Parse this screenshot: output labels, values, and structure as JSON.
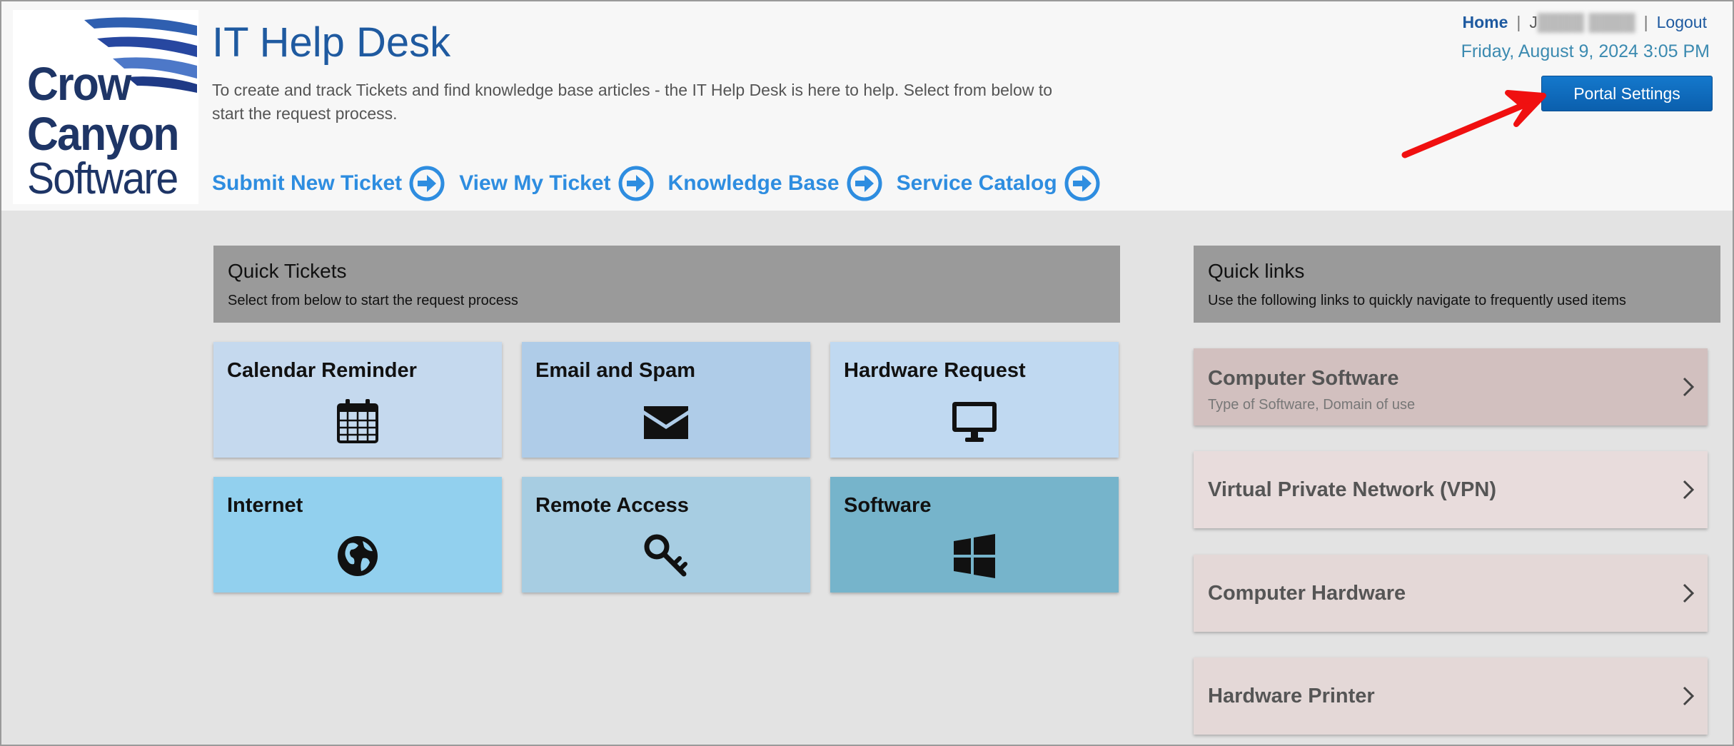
{
  "brand": {
    "logo_line1": "Crow",
    "logo_line2": "Canyon",
    "logo_line3": "Software",
    "color_dark": "#1e3566"
  },
  "header": {
    "title": "IT Help Desk",
    "description": "To create and track Tickets and find knowledge base articles - the IT Help Desk is here to help. Select from below to start the request process.",
    "home_label": "Home",
    "sep1": "|",
    "user_label": "J",
    "user_redacted": "████ ████",
    "sep2": "|",
    "logout_label": "Logout",
    "datetime": "Friday, August 9, 2024 3:05 PM",
    "portal_settings_label": "Portal Settings"
  },
  "nav": [
    {
      "label": "Submit New Ticket",
      "icon": "arrow-circle-right-icon"
    },
    {
      "label": "View My Ticket",
      "icon": "arrow-circle-right-icon"
    },
    {
      "label": "Knowledge Base",
      "icon": "arrow-circle-right-icon"
    },
    {
      "label": "Service Catalog",
      "icon": "arrow-circle-right-icon"
    }
  ],
  "quick_tickets": {
    "title": "Quick Tickets",
    "subtitle": "Select from below to start the request process",
    "tiles": [
      {
        "label": "Calendar Reminder",
        "icon": "calendar-icon",
        "color": "#c5d9ee"
      },
      {
        "label": "Email and Spam",
        "icon": "envelope-icon",
        "color": "#afcce8"
      },
      {
        "label": "Hardware Request",
        "icon": "monitor-icon",
        "color": "#c0d9f1"
      },
      {
        "label": "Internet",
        "icon": "globe-icon",
        "color": "#92d0ee"
      },
      {
        "label": "Remote Access",
        "icon": "key-icon",
        "color": "#a7cde2"
      },
      {
        "label": "Software",
        "icon": "windows-icon",
        "color": "#76b4cb"
      }
    ]
  },
  "quick_links": {
    "title": "Quick links",
    "subtitle": "Use the following links to quickly navigate to frequently used items",
    "items": [
      {
        "label": "Computer Software",
        "sub": "Type of Software, Domain of use",
        "color": "#d2c0bf"
      },
      {
        "label": "Virtual Private Network (VPN)",
        "sub": "",
        "color": "#e8dcdc"
      },
      {
        "label": "Computer Hardware",
        "sub": "",
        "color": "#e4d8d7"
      },
      {
        "label": "Hardware Printer",
        "sub": "",
        "color": "#e4d8d7"
      }
    ]
  },
  "colors": {
    "accent": "#2e8de0",
    "title": "#1f5aa0",
    "annotation_arrow": "#f01010"
  }
}
